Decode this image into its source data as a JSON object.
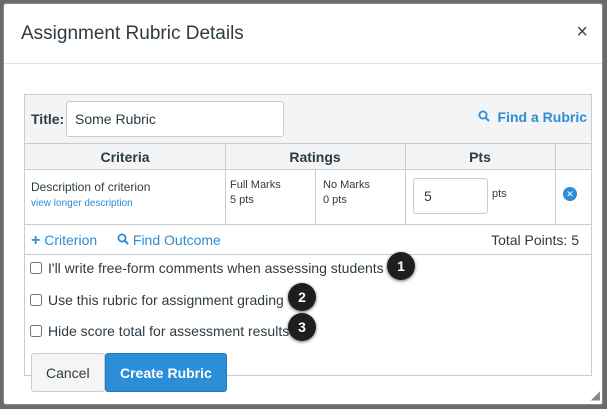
{
  "dialog": {
    "title": "Assignment Rubric Details",
    "close_glyph": "×"
  },
  "rubric": {
    "title_label": "Title:",
    "title_value": "Some Rubric",
    "find_rubric_label": "Find a Rubric",
    "columns": [
      "Criteria",
      "Ratings",
      "Pts"
    ],
    "criterion": {
      "description": "Description of criterion",
      "long_link": "view longer description",
      "ratings": [
        {
          "label": "Full Marks",
          "points": "5 pts"
        },
        {
          "label": "No Marks",
          "points": "0 pts"
        }
      ],
      "points_value": "5",
      "points_unit": "pts"
    },
    "add_criterion_label": "Criterion",
    "find_outcome_label": "Find Outcome",
    "total_points": "Total Points: 5"
  },
  "options": [
    {
      "label": "I'll write free-form comments when assessing students",
      "badge": "1"
    },
    {
      "label": "Use this rubric for assignment grading",
      "badge": "2"
    },
    {
      "label": "Hide score total for assessment results",
      "badge": "3"
    }
  ],
  "buttons": {
    "cancel": "Cancel",
    "create": "Create Rubric"
  },
  "colors": {
    "accent": "#2b8ed6",
    "header_bg": "#f2f4f5"
  }
}
